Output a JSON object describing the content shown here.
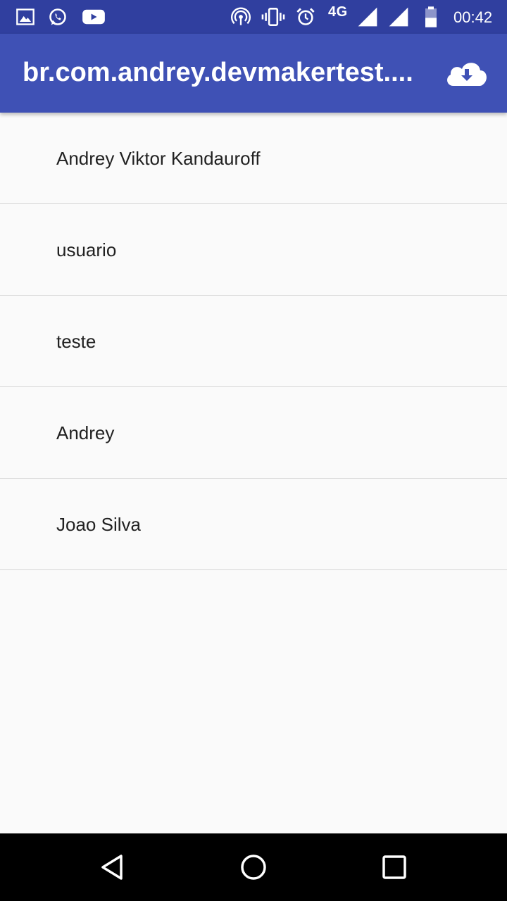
{
  "status_bar": {
    "network": "4G",
    "time": "00:42",
    "icons": [
      "gallery-icon",
      "whatsapp-icon",
      "youtube-icon",
      "hotspot-icon",
      "vibrate-icon",
      "alarm-icon",
      "signal-icon",
      "signal-icon",
      "battery-icon"
    ]
  },
  "app_bar": {
    "title": "br.com.andrey.devmakertest....",
    "action_icon": "cloud-download-icon",
    "color": "#3f51b5"
  },
  "list": {
    "items": [
      {
        "label": "Andrey Viktor Kandauroff"
      },
      {
        "label": "usuario"
      },
      {
        "label": "teste"
      },
      {
        "label": "Andrey"
      },
      {
        "label": "Joao Silva"
      }
    ]
  },
  "nav_bar": {
    "buttons": [
      "back-icon",
      "home-icon",
      "recents-icon"
    ]
  },
  "colors": {
    "status_bar": "#303f9f",
    "app_bar": "#3f51b5",
    "background": "#fafafa",
    "divider": "#d6d6d6"
  }
}
